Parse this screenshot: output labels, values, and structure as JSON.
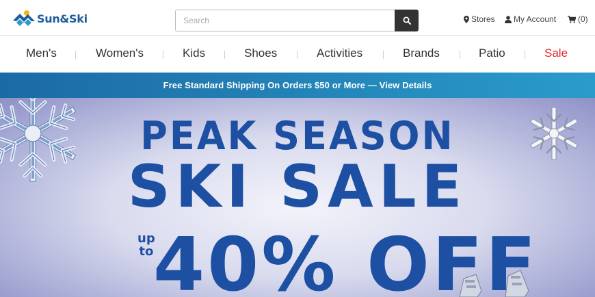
{
  "brand": {
    "name": "Sun&Ski",
    "color": "#1c5c9c"
  },
  "search": {
    "placeholder": "Search"
  },
  "utility": {
    "stores": "Stores",
    "account": "My Account",
    "cart": "(0)"
  },
  "nav": {
    "items": [
      "Men's",
      "Women's",
      "Kids",
      "Shoes",
      "Activities",
      "Brands",
      "Patio",
      "Sale"
    ]
  },
  "promo": {
    "text": "Free Standard Shipping On Orders $50 or More — View Details"
  },
  "hero": {
    "line1": "PEAK SEASON",
    "line2": "SKI SALE",
    "upto_1": "up",
    "upto_2": "to",
    "line3": "40% OFF"
  },
  "colors": {
    "sale": "#e0262f",
    "promo_start": "#1b6aa4",
    "promo_end": "#2a9cc9",
    "hero_text": "#1d4fa3"
  }
}
